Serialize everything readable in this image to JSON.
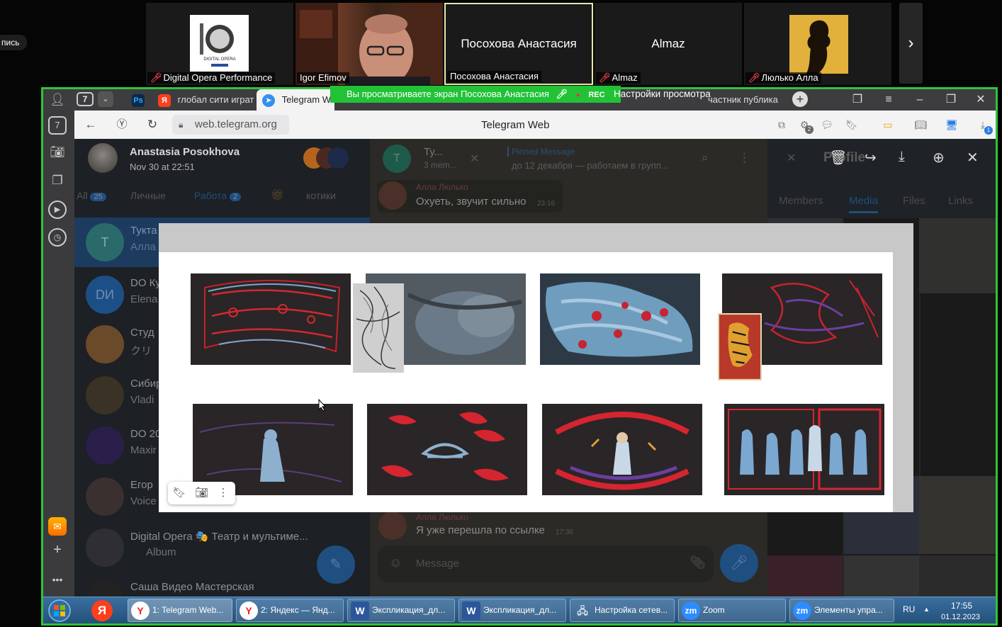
{
  "zoom": {
    "record_label": "пись",
    "participants": [
      {
        "name": "Digital Opera Performance",
        "muted": true,
        "logo_text": "DIGITAL OPERA"
      },
      {
        "name": "Igor Efimov",
        "muted": false
      },
      {
        "name": "Посохова Анастасия",
        "big_name": "Посохова Анастасия",
        "muted": false
      },
      {
        "name": "Almaz",
        "big_name": "Almaz",
        "muted": true
      },
      {
        "name": "Люлько Алла",
        "muted": true
      }
    ],
    "share_banner": "Вы просматриваете экран  Посохова Анастасия",
    "rec_label": "REC",
    "view_settings": "Настройки просмотра"
  },
  "browser": {
    "tab_count": "7",
    "tabs": [
      {
        "label": "Ps",
        "icon": "photoshop-icon"
      },
      {
        "label": "глобал сити играт",
        "icon": "yandex-icon"
      },
      {
        "label": "Telegram Web",
        "icon": "telegram-icon"
      },
      {
        "label": "частник публика",
        "icon": "telegram-icon"
      }
    ],
    "url": "web.telegram.org",
    "page_title": "Telegram Web",
    "download_badge": "1",
    "ext_badge": "2"
  },
  "telegram": {
    "viewer_author": "Anastasia Posokhova",
    "viewer_date": "Nov 30 at 22:51",
    "folders": [
      {
        "label": "All",
        "count": "25"
      },
      {
        "label": "Личные"
      },
      {
        "label": "Работа",
        "count": "2"
      },
      {
        "label": "котики"
      }
    ],
    "chats": [
      {
        "initials": "T",
        "title": "Тукта",
        "preview": "Алла"
      },
      {
        "initials": "DИ",
        "title": "DO Ку",
        "preview": "Elena"
      },
      {
        "initials": "",
        "title": "Студ",
        "preview": "クリ"
      },
      {
        "initials": "",
        "title": "Сибир",
        "preview": "Vladi"
      },
      {
        "initials": "",
        "title": "DO 20",
        "preview": "Maxir"
      },
      {
        "initials": "",
        "title": "Егор",
        "preview": "Voice"
      },
      {
        "initials": "",
        "title": "Digital Opera 🎭 Театр и мультиме...",
        "preview": "Album"
      },
      {
        "initials": "",
        "title": "Саша Видео Мастерская",
        "preview": ""
      }
    ],
    "group_title": "Ту...",
    "group_sub": "3 mem...",
    "pinned_label": "Pinned Message",
    "pinned_text": "до 12 декабря — работаем в групп...",
    "messages": [
      {
        "author": "Алла Люлько",
        "text": "Охуеть, звучит сильно",
        "time": "23:16"
      },
      {
        "author": "Алла Люлько",
        "text": "Я уже перешла по ссылке",
        "time": "17:36"
      }
    ],
    "message_placeholder": "Message",
    "profile_title": "Profile",
    "profile_tabs": [
      "Members",
      "Media",
      "Files",
      "Links"
    ]
  },
  "taskbar": {
    "buttons": [
      {
        "label": "1: Telegram Web...",
        "icon": "yandex-browser-icon"
      },
      {
        "label": "2: Яндекс — Янд...",
        "icon": "yandex-browser-icon"
      },
      {
        "label": "Экспликация_дл...",
        "icon": "word-icon"
      },
      {
        "label": "Экспликация_дл...",
        "icon": "word-icon"
      },
      {
        "label": "Настройка сетев...",
        "icon": "network-icon"
      },
      {
        "label": "Zoom",
        "icon": "zoom-icon"
      },
      {
        "label": "Элементы упра...",
        "icon": "zoom-icon"
      }
    ],
    "lang": "RU",
    "time": "17:55",
    "date": "01.12.2023"
  },
  "colors": {
    "share_green": "#2fc33a",
    "telegram_blue": "#3390ec",
    "zoom_blue": "#2d8cff"
  }
}
